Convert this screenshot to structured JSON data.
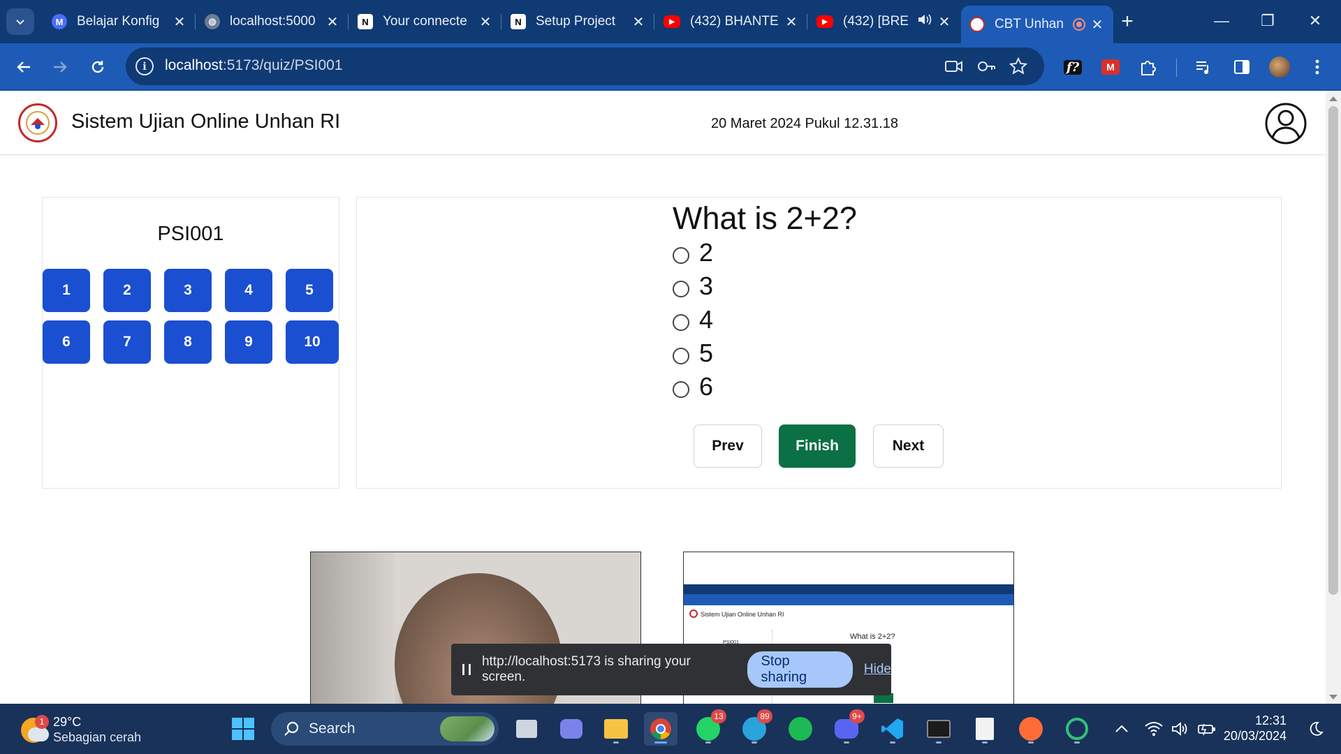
{
  "browser": {
    "tabs": [
      {
        "title": "Belajar Konfig",
        "favicon": "meta-icon",
        "color": "#4a6cf7"
      },
      {
        "title": "localhost:5000",
        "favicon": "globe-icon",
        "color": "#c4cbd6"
      },
      {
        "title": "Your connecte",
        "favicon": "notion-icon",
        "color": "#ffffff"
      },
      {
        "title": "Setup Project",
        "favicon": "notion-icon",
        "color": "#ffffff"
      },
      {
        "title": "(432) BHANTE",
        "favicon": "youtube-icon",
        "color": "#ff0000"
      },
      {
        "title": "(432) [BRE",
        "favicon": "youtube-icon",
        "color": "#ff0000"
      },
      {
        "title": "CBT Unhan",
        "favicon": "unhan-icon",
        "color": "#c62828"
      }
    ],
    "url_host": "localhost",
    "url_path": ":5173/quiz/PSI001",
    "accent": "#1e5bb6"
  },
  "page": {
    "site_title": "Sistem Ujian Online Unhan RI",
    "datetime": "20 Maret 2024 Pukul 12.31.18",
    "quiz_code": "PSI001",
    "question_numbers": [
      "1",
      "2",
      "3",
      "4",
      "5",
      "6",
      "7",
      "8",
      "9",
      "10"
    ],
    "question": "What is 2+2?",
    "options": [
      "2",
      "3",
      "4",
      "5",
      "6"
    ],
    "buttons": {
      "prev": "Prev",
      "finish": "Finish",
      "next": "Next"
    },
    "colors": {
      "question_button": "#1b4fd1",
      "finish": "#0c7045"
    }
  },
  "screenshare_preview": {
    "title": "Sistem Ujian Online Unhan RI",
    "code": "PSI001",
    "question": "What is 2+2?"
  },
  "share_bar": {
    "message": "http://localhost:5173 is sharing your screen.",
    "stop": "Stop sharing",
    "hide": "Hide"
  },
  "taskbar": {
    "weather_badge": "1",
    "temperature": "29°C",
    "weather": "Sebagian cerah",
    "search": "Search",
    "whatsapp_badge": "13",
    "telegram_badge": "89",
    "discord_badge": "9+",
    "time": "12:31",
    "date": "20/03/2024"
  }
}
